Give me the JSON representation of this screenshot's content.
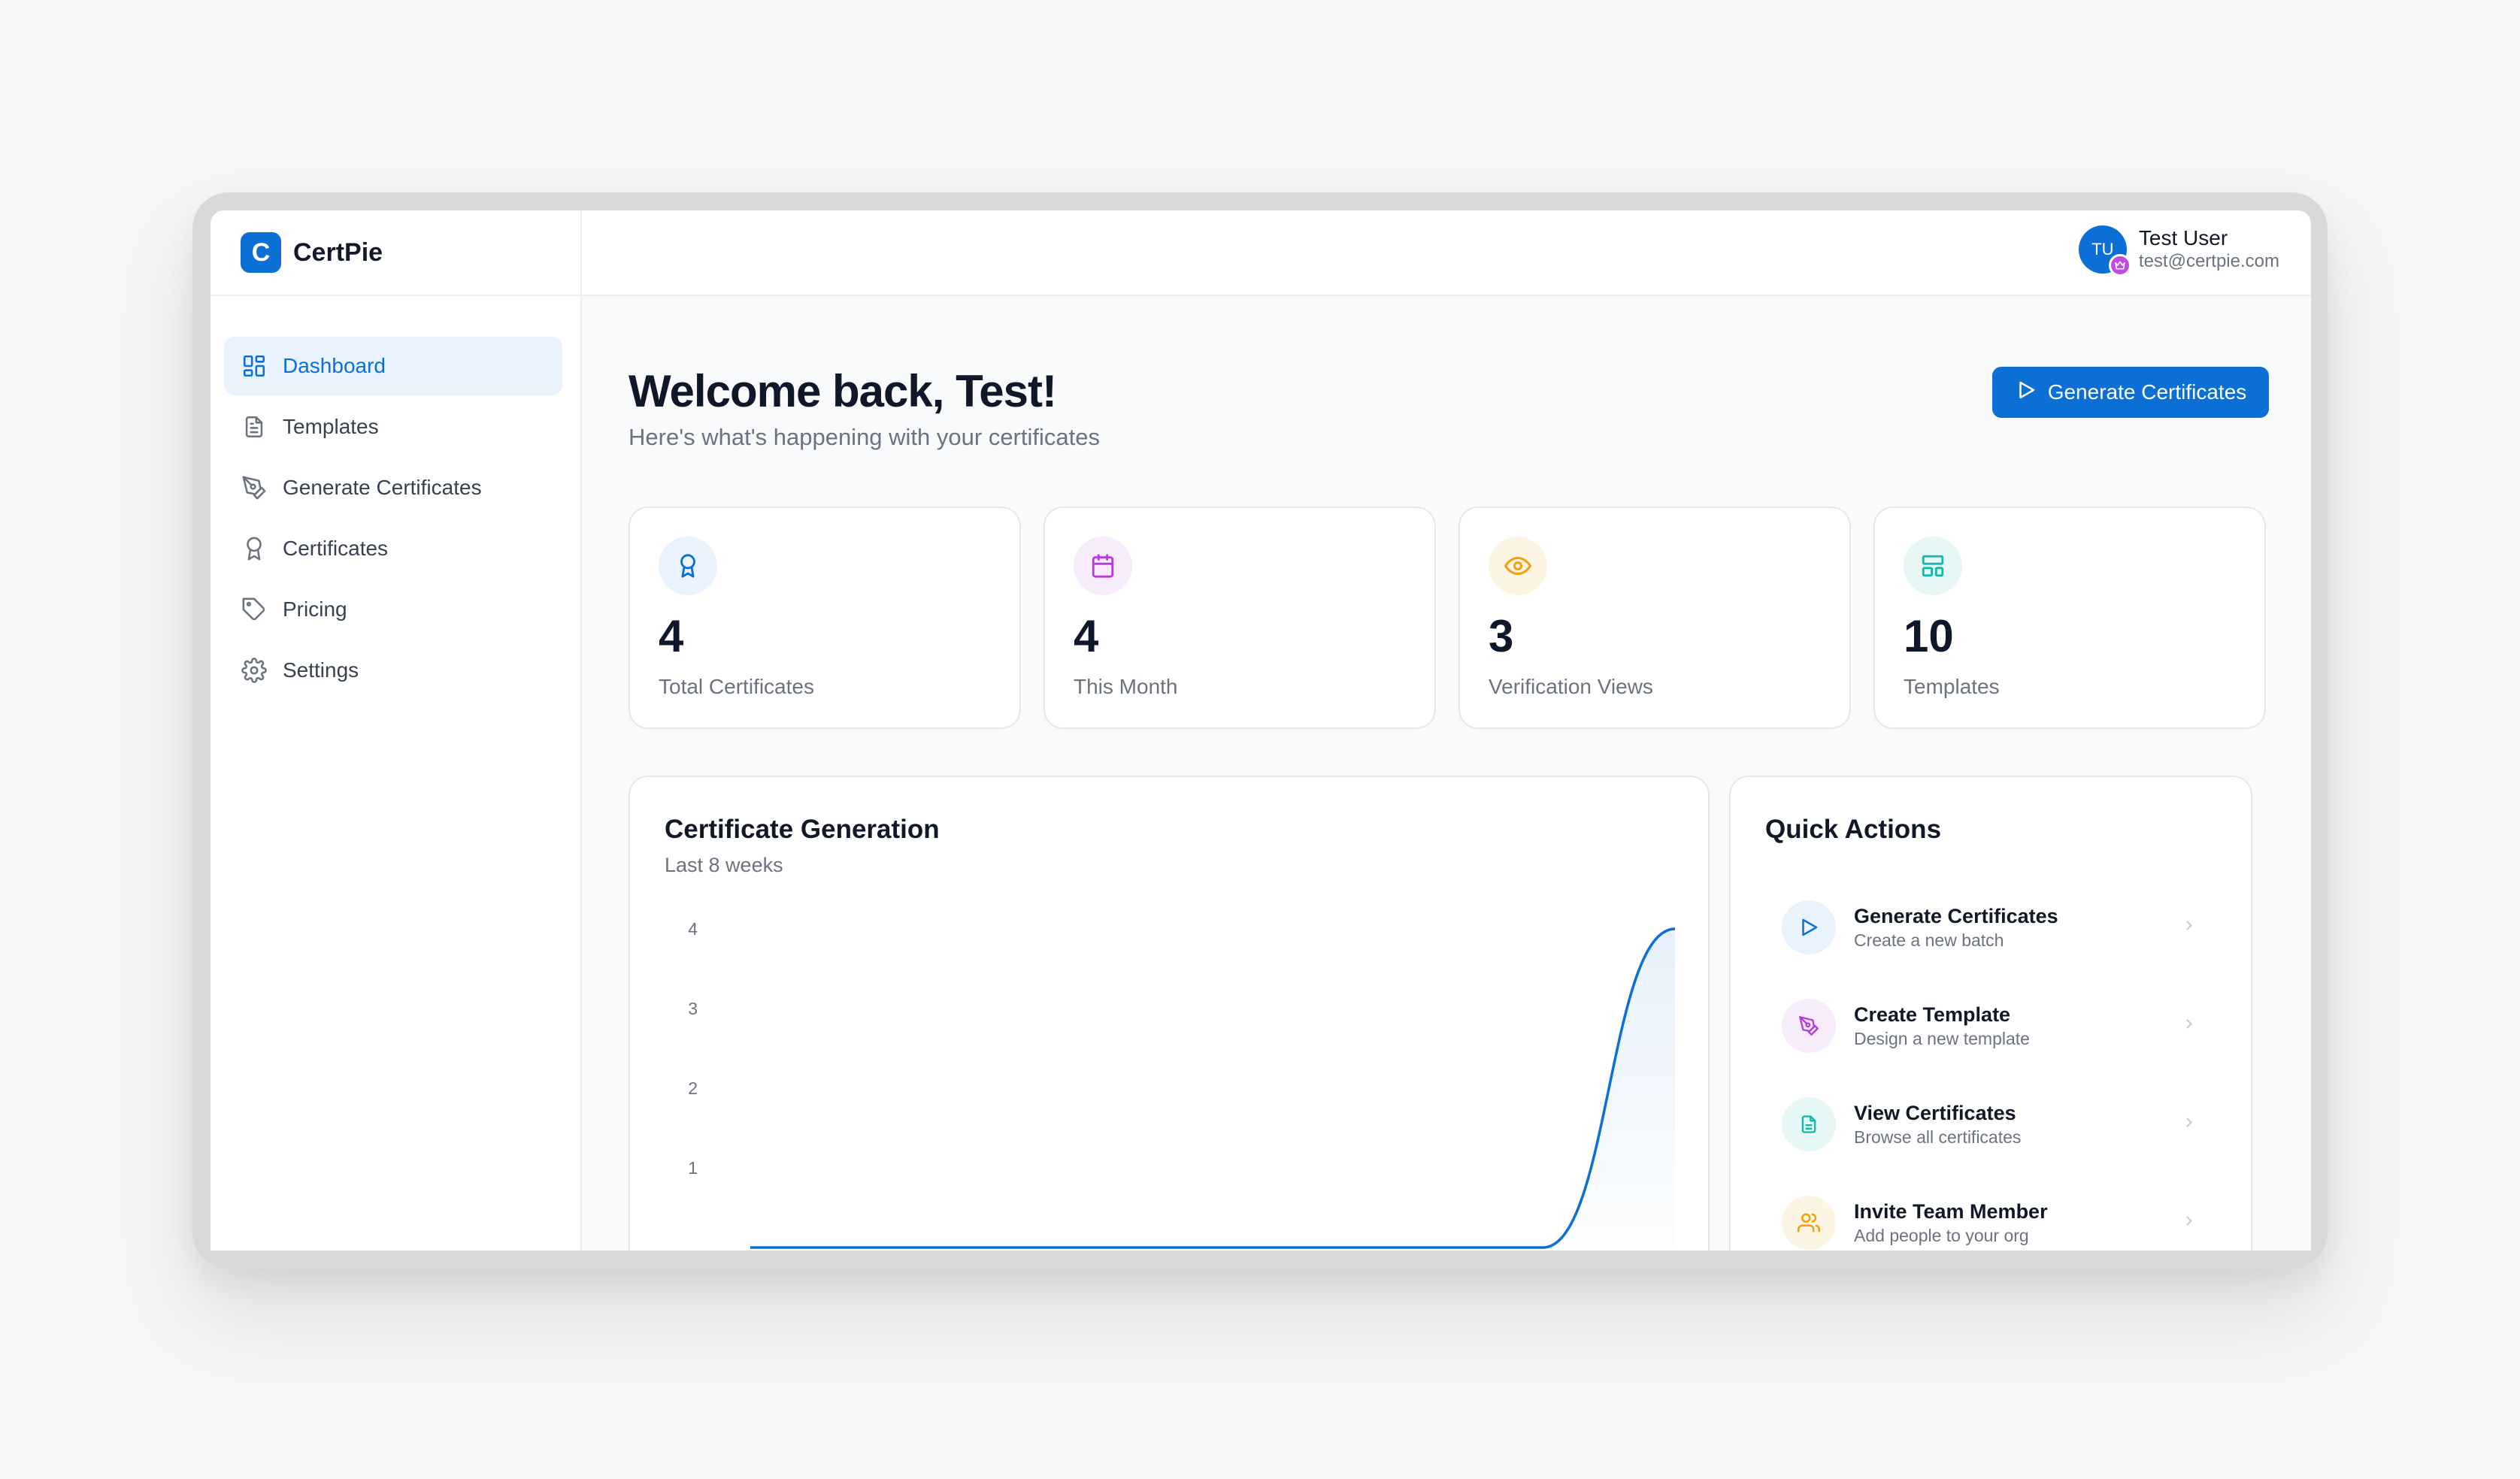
{
  "brand": {
    "logo_letter": "C",
    "name": "CertPie"
  },
  "sidebar": {
    "items": [
      {
        "label": "Dashboard",
        "icon": "dashboard-icon",
        "active": true
      },
      {
        "label": "Templates",
        "icon": "file-icon"
      },
      {
        "label": "Generate Certificates",
        "icon": "pen-tool-icon"
      },
      {
        "label": "Certificates",
        "icon": "award-icon"
      },
      {
        "label": "Pricing",
        "icon": "tag-icon"
      },
      {
        "label": "Settings",
        "icon": "gear-icon"
      }
    ]
  },
  "user": {
    "initials": "TU",
    "name": "Test User",
    "email": "test@certpie.com"
  },
  "main": {
    "title": "Welcome back, Test!",
    "subtitle": "Here's what's happening with your certificates",
    "primary_button": "Generate Certificates"
  },
  "stats": [
    {
      "value": "4",
      "label": "Total Certificates",
      "icon": "award-icon",
      "color": "#0b6fd6",
      "bg": "#e8f3fe"
    },
    {
      "value": "4",
      "label": "This Month",
      "icon": "calendar-icon",
      "color": "#b43cd8",
      "bg": "#f7ecfc"
    },
    {
      "value": "3",
      "label": "Verification Views",
      "icon": "eye-icon",
      "color": "#f59e0b",
      "bg": "#fdf5e4"
    },
    {
      "value": "10",
      "label": "Templates",
      "icon": "layout-icon",
      "color": "#14b8a6",
      "bg": "#e6f8f5"
    }
  ],
  "chart": {
    "title": "Certificate Generation",
    "subtitle": "Last 8 weeks"
  },
  "chart_data": {
    "type": "area",
    "title": "Certificate Generation",
    "subtitle": "Last 8 weeks",
    "y_ticks": [
      4,
      3,
      2,
      1
    ],
    "ylim": [
      0,
      4
    ],
    "grid": false,
    "x": [
      1,
      2,
      3,
      4,
      5,
      6,
      7,
      8
    ],
    "values": [
      0,
      0,
      0,
      0,
      0,
      0,
      0,
      4
    ],
    "color": "#0b6fd6"
  },
  "quick_actions": {
    "title": "Quick Actions",
    "items": [
      {
        "label": "Generate Certificates",
        "desc": "Create a new batch",
        "icon": "play-icon",
        "color": "#0b6fd6",
        "bg": "#e8f3fe"
      },
      {
        "label": "Create Template",
        "desc": "Design a new template",
        "icon": "pen-tool-icon",
        "color": "#b43cd8",
        "bg": "#f7ecfc"
      },
      {
        "label": "View Certificates",
        "desc": "Browse all certificates",
        "icon": "file-icon",
        "color": "#14b8a6",
        "bg": "#e6f8f5"
      },
      {
        "label": "Invite Team Member",
        "desc": "Add people to your org",
        "icon": "users-icon",
        "color": "#f59e0b",
        "bg": "#fdf5e4"
      }
    ]
  }
}
